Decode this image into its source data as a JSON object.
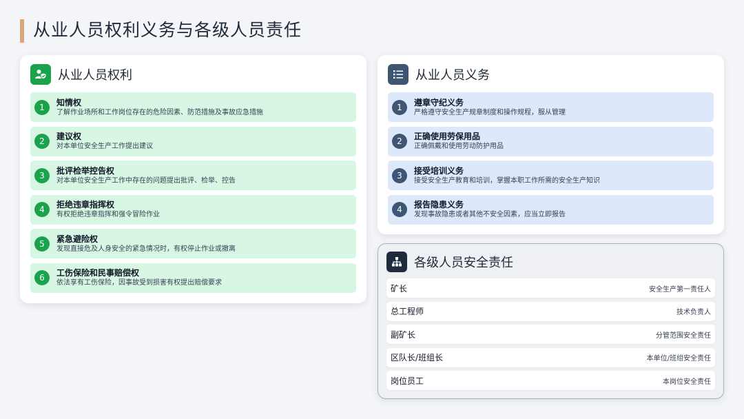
{
  "page": {
    "title": "从业人员权利义务与各级人员责任"
  },
  "rights": {
    "title": "从业人员权利",
    "icon": "user-shield-icon",
    "items": [
      {
        "num": "1",
        "title": "知情权",
        "desc": "了解作业场所和工作岗位存在的危险因素、防范措施及事故应急措施"
      },
      {
        "num": "2",
        "title": "建议权",
        "desc": "对本单位安全生产工作提出建议"
      },
      {
        "num": "3",
        "title": "批评检举控告权",
        "desc": "对本单位安全生产工作中存在的问题提出批评、检举、控告"
      },
      {
        "num": "4",
        "title": "拒绝违章指挥权",
        "desc": "有权拒绝违章指挥和强令冒险作业"
      },
      {
        "num": "5",
        "title": "紧急避险权",
        "desc": "发现直接危及人身安全的紧急情况时，有权停止作业或撤离"
      },
      {
        "num": "6",
        "title": "工伤保险和民事赔偿权",
        "desc": "依法享有工伤保险，因事故受到损害有权提出赔偿要求"
      }
    ]
  },
  "duties": {
    "title": "从业人员义务",
    "icon": "checklist-icon",
    "items": [
      {
        "num": "1",
        "title": "遵章守纪义务",
        "desc": "严格遵守安全生产规章制度和操作规程，服从管理"
      },
      {
        "num": "2",
        "title": "正确使用劳保用品",
        "desc": "正确佩戴和使用劳动防护用品"
      },
      {
        "num": "3",
        "title": "接受培训义务",
        "desc": "接受安全生产教育和培训，掌握本职工作所需的安全生产知识"
      },
      {
        "num": "4",
        "title": "报告隐患义务",
        "desc": "发现事故隐患或者其他不安全因素，应当立即报告"
      }
    ]
  },
  "responsibility": {
    "title": "各级人员安全责任",
    "icon": "org-chart-icon",
    "rows": [
      {
        "role": "矿长",
        "duty": "安全生产第一责任人"
      },
      {
        "role": "总工程师",
        "duty": "技术负责人"
      },
      {
        "role": "副矿长",
        "duty": "分管范围安全责任"
      },
      {
        "role": "区队长/班组长",
        "duty": "本单位/班组安全责任"
      },
      {
        "role": "岗位员工",
        "duty": "本岗位安全责任"
      }
    ]
  },
  "colors": {
    "accent_bar": "#d9a67a",
    "green": "#1aa34a",
    "green_light": "#d7f7e4",
    "slate": "#3e5674",
    "blue_light": "#dde9fb",
    "navy": "#1f2a3d"
  }
}
